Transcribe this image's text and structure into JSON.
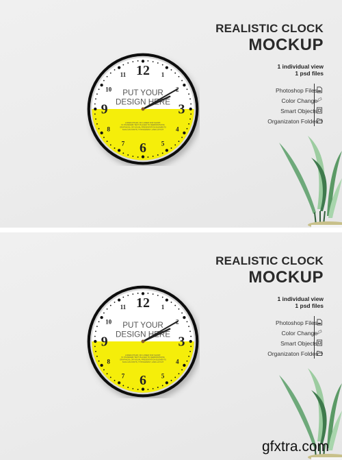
{
  "panels": [
    {
      "title_line1": "REALISTIC CLOCK",
      "title_line2": "MOCKUP",
      "sub_line1": "1 individual view",
      "sub_line2": "1 psd files",
      "features": [
        {
          "label": "Photoshop Files",
          "icon": "file-icon"
        },
        {
          "label": "Color Change",
          "icon": "paint-icon"
        },
        {
          "label": "Smart Objects",
          "icon": "smart-object-icon"
        },
        {
          "label": "Organizaton Folder",
          "icon": "folder-icon"
        }
      ],
      "clock": {
        "design_text_line1": "PUT YOUR",
        "design_text_line2": "DESIGN HERE",
        "lorem": [
          "LOREM IPSUM, OR LOREM FOR SHORT,",
          "IS STANDARD TEXT PLACED TO DEMONSTRATE",
          "GRAPHICAL OR VISUAL PRESENTATION ELEMENTS",
          "SUCH AS FONTS, TYPOGRAPHY, AND LAYOUT"
        ],
        "numerals": [
          "12",
          "1",
          "2",
          "3",
          "4",
          "5",
          "6",
          "7",
          "8",
          "9",
          "10",
          "11"
        ],
        "time": "2:10",
        "top_color": "#ffffff",
        "bottom_color": "#f5ee0a",
        "rim_color": "#111111"
      }
    },
    {
      "title_line1": "REALISTIC CLOCK",
      "title_line2": "MOCKUP",
      "sub_line1": "1 individual view",
      "sub_line2": "1 psd files",
      "features": [
        {
          "label": "Photoshop Files",
          "icon": "file-icon"
        },
        {
          "label": "Color Change",
          "icon": "paint-icon"
        },
        {
          "label": "Smart Objects",
          "icon": "smart-object-icon"
        },
        {
          "label": "Organizaton Folder",
          "icon": "folder-icon"
        }
      ],
      "clock": {
        "design_text_line1": "PUT YOUR",
        "design_text_line2": "DESIGN HERE",
        "lorem": [
          "LOREM IPSUM, OR LOREM FOR SHORT,",
          "IS STANDARD TEXT PLACED TO DEMONSTRATE",
          "GRAPHICAL OR VISUAL PRESENTATION ELEMENTS",
          "SUCH AS FONTS, TYPOGRAPHY, AND LAYOUT"
        ],
        "numerals": [
          "12",
          "1",
          "2",
          "3",
          "4",
          "5",
          "6",
          "7",
          "8",
          "9",
          "10",
          "11"
        ],
        "time": "2:10",
        "top_color": "#ffffff",
        "bottom_color": "#f5ee0a",
        "rim_color": "#111111"
      }
    }
  ],
  "watermark": "gfxtra.com"
}
